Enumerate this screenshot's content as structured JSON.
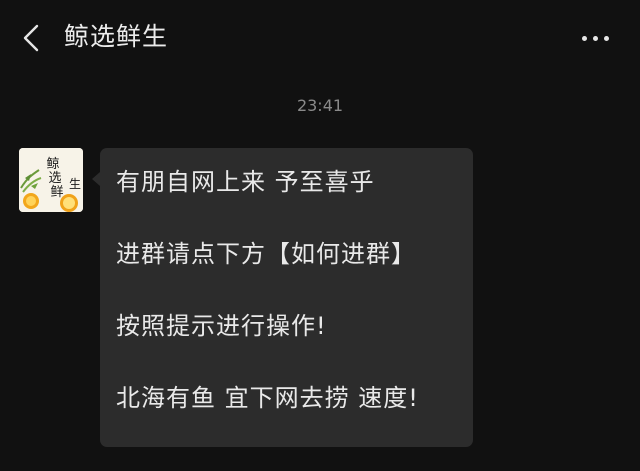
{
  "header": {
    "title": "鲸选鲜生",
    "back_icon": "chevron-left-icon",
    "more_icon": "more-dots-icon"
  },
  "chat": {
    "timestamp": "23:41",
    "message": {
      "sender_avatar_text": "鲸选鲜生",
      "lines": [
        "有朋自网上来 予至喜乎",
        "进群请点下方【如何进群】",
        "按照提示进行操作!",
        "北海有鱼 宜下网去捞  速度!"
      ]
    }
  },
  "colors": {
    "background": "#111111",
    "bubble": "#2c2c2c",
    "text": "#e9e9e9",
    "timestamp": "#8a8a8a"
  }
}
